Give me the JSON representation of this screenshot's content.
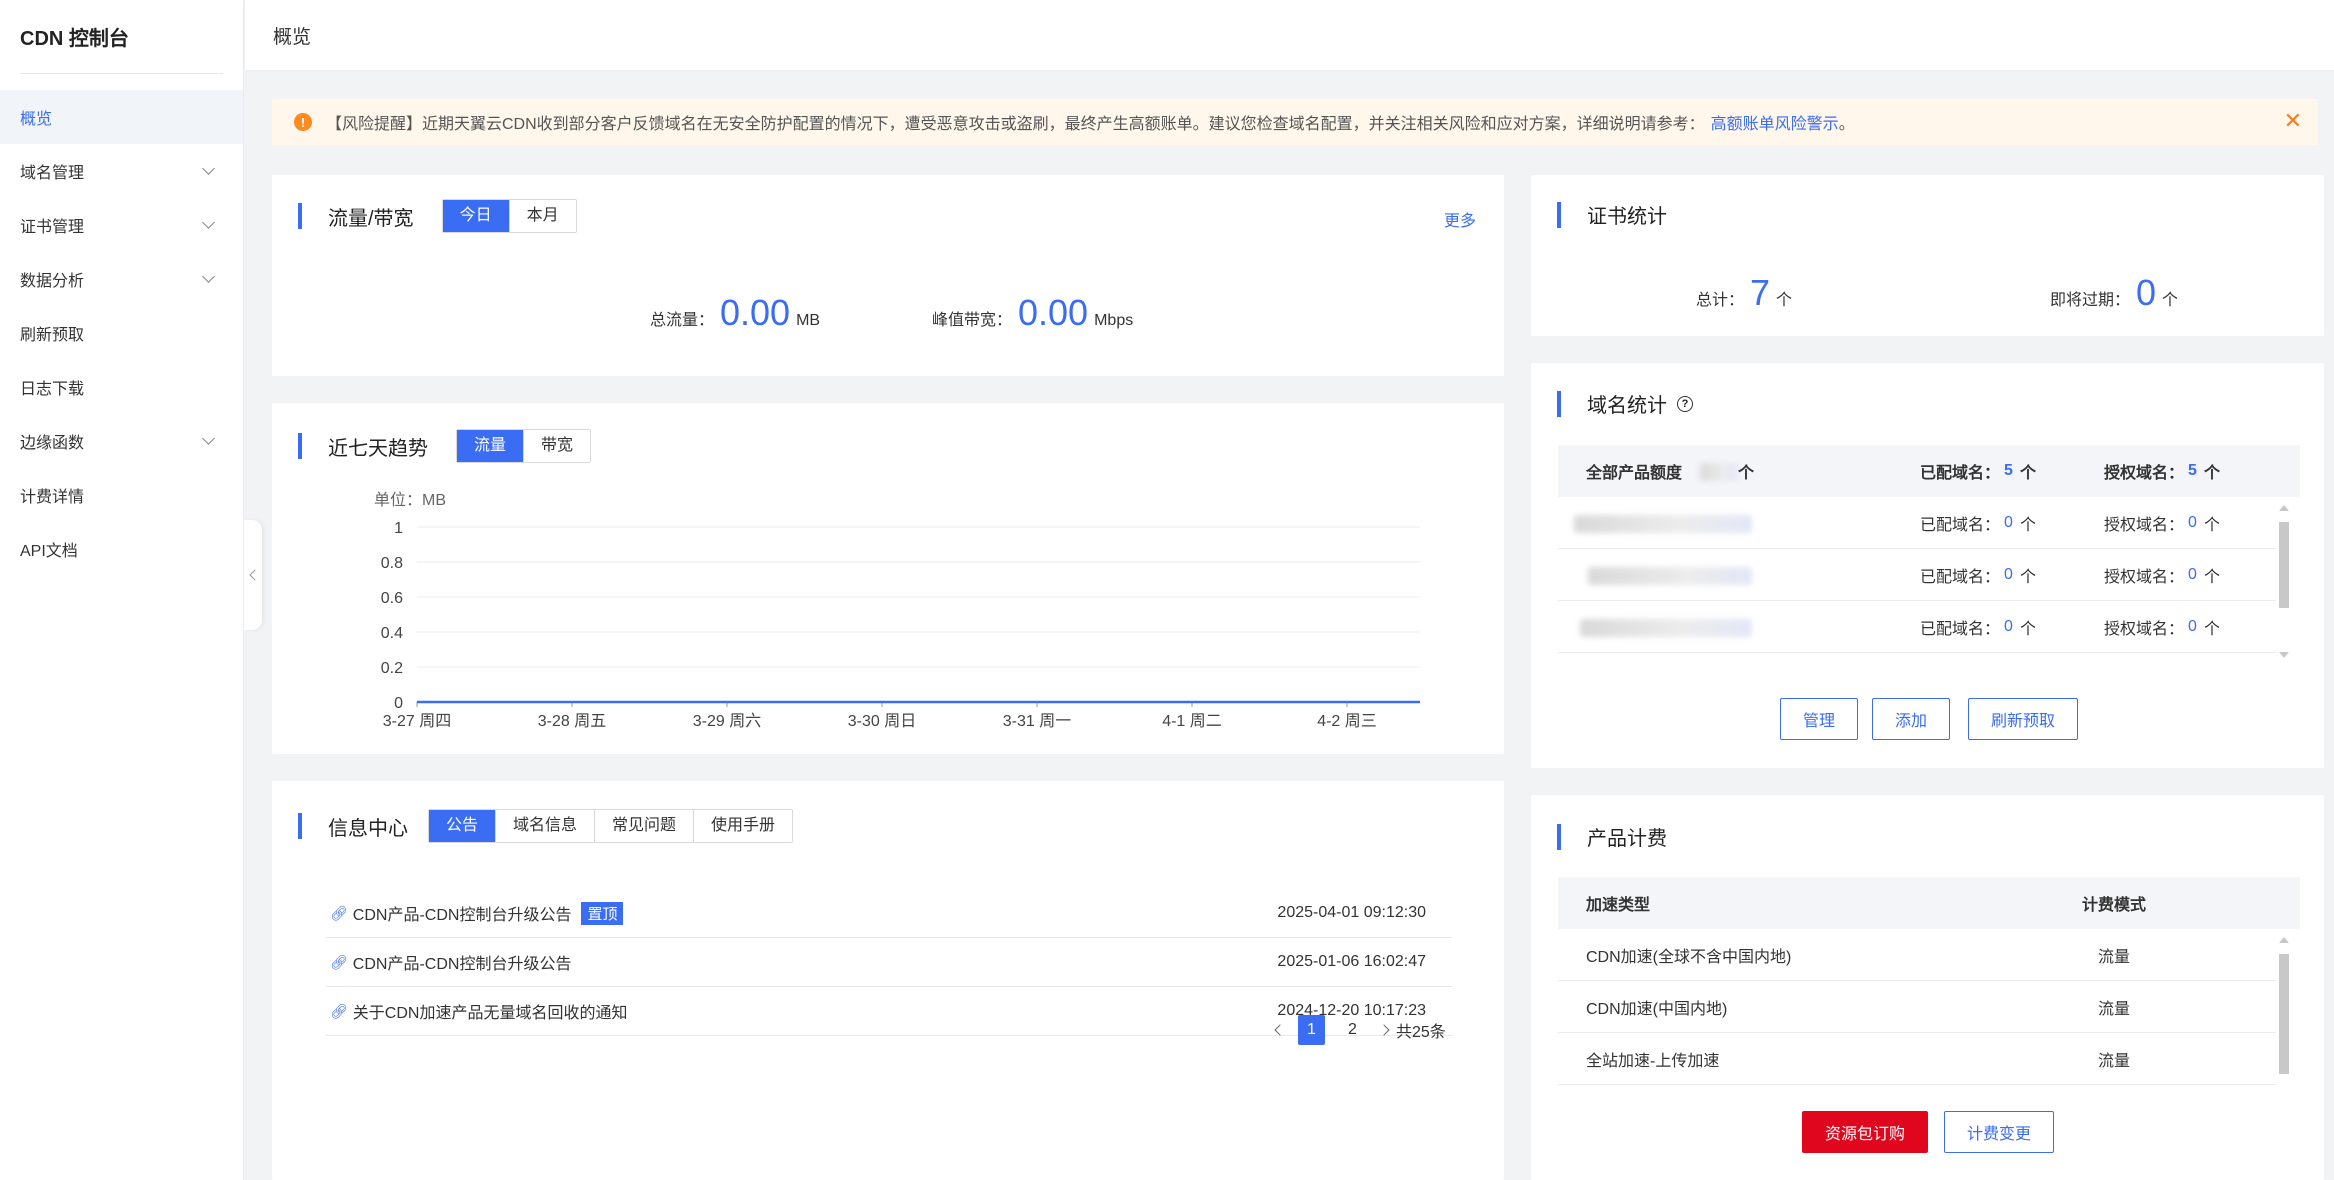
{
  "sidebar": {
    "title": "CDN 控制台",
    "items": [
      {
        "label": "概览",
        "active": true,
        "expandable": false
      },
      {
        "label": "域名管理",
        "active": false,
        "expandable": true
      },
      {
        "label": "证书管理",
        "active": false,
        "expandable": true
      },
      {
        "label": "数据分析",
        "active": false,
        "expandable": true
      },
      {
        "label": "刷新预取",
        "active": false,
        "expandable": false
      },
      {
        "label": "日志下载",
        "active": false,
        "expandable": false
      },
      {
        "label": "边缘函数",
        "active": false,
        "expandable": true
      },
      {
        "label": "计费详情",
        "active": false,
        "expandable": false
      },
      {
        "label": "API文档",
        "active": false,
        "expandable": false
      }
    ]
  },
  "header": {
    "title": "概览"
  },
  "alert": {
    "text": "【风险提醒】近期天翼云CDN收到部分客户反馈域名在无安全防护配置的情况下，遭受恶意攻击或盗刷，最终产生高额账单。建议您检查域名配置，并关注相关风险和应对方案，详细说明请参考：",
    "link": "高额账单风险警示",
    "suffix": "。",
    "close": "✕"
  },
  "traffic": {
    "title": "流量/带宽",
    "tabs": [
      "今日",
      "本月"
    ],
    "more": "更多",
    "total_label": "总流量：",
    "total_value": "0.00",
    "total_unit": "MB",
    "peak_label": "峰值带宽：",
    "peak_value": "0.00",
    "peak_unit": "Mbps"
  },
  "trend": {
    "title": "近七天趋势",
    "tabs": [
      "流量",
      "带宽"
    ],
    "unit_label": "单位：MB"
  },
  "chart_data": {
    "type": "line",
    "categories": [
      "3-27 周四",
      "3-28 周五",
      "3-29 周六",
      "3-30 周日",
      "3-31 周一",
      "4-1 周二",
      "4-2 周三"
    ],
    "series": [
      {
        "values": [
          0,
          0,
          0,
          0,
          0,
          0,
          0
        ]
      }
    ],
    "yticks": [
      "0",
      "0.2",
      "0.4",
      "0.6",
      "0.8",
      "1"
    ],
    "ylim": [
      0,
      1
    ],
    "ylabel": "单位：MB",
    "grid": true,
    "line_color": "#3a6cf4"
  },
  "info": {
    "title": "信息中心",
    "tabs": [
      "公告",
      "域名信息",
      "常见问题",
      "使用手册"
    ],
    "items": [
      {
        "title": "CDN产品-CDN控制台升级公告",
        "tag": "置顶",
        "time": "2025-04-01 09:12:30"
      },
      {
        "title": "CDN产品-CDN控制台升级公告",
        "tag": "",
        "time": "2025-01-06 16:02:47"
      },
      {
        "title": "关于CDN加速产品无量域名回收的通知",
        "tag": "",
        "time": "2024-12-20 10:17:23"
      }
    ],
    "pages": [
      "1",
      "2"
    ],
    "total": "共25条"
  },
  "cert": {
    "title": "证书统计",
    "total_label": "总计：",
    "total_value": "7",
    "total_unit": "个",
    "expiring_label": "即将过期：",
    "expiring_value": "0",
    "expiring_unit": "个"
  },
  "domain": {
    "title": "域名统计",
    "help": "?",
    "header": {
      "quota_label": "全部产品额度",
      "quota_unit": "个",
      "configured_label": "已配域名：",
      "configured_value": "5",
      "authorized_label": "授权域名：",
      "authorized_value": "5",
      "unit": "个"
    },
    "rows": [
      {
        "configured_label": "已配域名：",
        "configured": "0",
        "authorized_label": "授权域名：",
        "authorized": "0",
        "unit": "个"
      },
      {
        "configured_label": "已配域名：",
        "configured": "0",
        "authorized_label": "授权域名：",
        "authorized": "0",
        "unit": "个"
      },
      {
        "configured_label": "已配域名：",
        "configured": "0",
        "authorized_label": "授权域名：",
        "authorized": "0",
        "unit": "个"
      }
    ],
    "buttons": [
      "管理",
      "添加",
      "刷新预取"
    ]
  },
  "billing": {
    "title": "产品计费",
    "col_type": "加速类型",
    "col_mode": "计费模式",
    "rows": [
      {
        "type": "CDN加速(全球不含中国内地)",
        "mode": "流量"
      },
      {
        "type": "CDN加速(中国内地)",
        "mode": "流量"
      },
      {
        "type": "全站加速-上传加速",
        "mode": "流量"
      }
    ],
    "buttons": [
      "资源包订购",
      "计费变更"
    ]
  }
}
